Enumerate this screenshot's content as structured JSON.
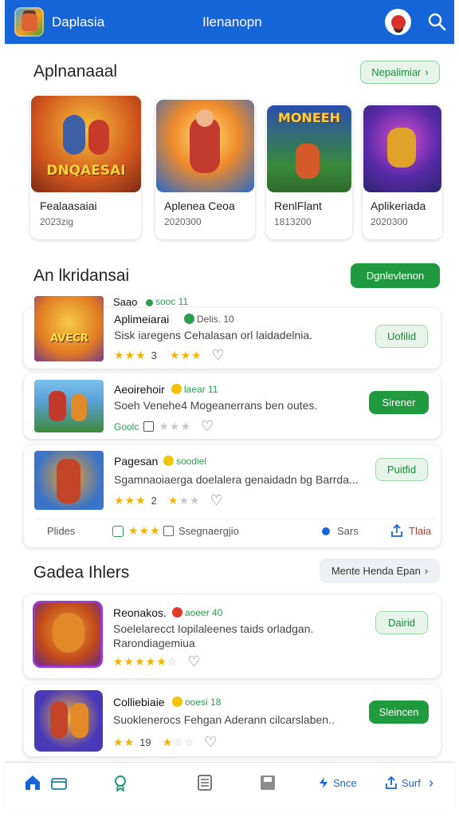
{
  "header": {
    "app_name": "Daplasia",
    "title": "Ilenanopn"
  },
  "featured": {
    "title": "Aplnanaaal",
    "button": "Nepalimiar",
    "items": [
      {
        "name": "Fealaasaiai",
        "sub": "2023zig",
        "art": "DNQAESAI"
      },
      {
        "name": "Aplenea Ceoa",
        "sub": "2020300",
        "art": ""
      },
      {
        "name": "RenlFlant",
        "sub": "1813200",
        "art": "MONEEH"
      },
      {
        "name": "Aplikeriada",
        "sub": "2020300",
        "art": ""
      }
    ]
  },
  "list_section": {
    "title": "An lkridansai",
    "button": "Dgnlevlenon",
    "header_name": "Saao",
    "header_tag": "sooc 11",
    "items": [
      {
        "name": "Aplimeiarai",
        "tag": "Delis. 10",
        "desc": "Sisk iaregens Cehalasan orl laidadelnia.",
        "stars_on": "★★★",
        "rating": "3",
        "stars_on2": "★★★",
        "stars_off": "",
        "button": "Uofilid",
        "style": "light",
        "banner": "AVECR"
      },
      {
        "name": "Aeoirehoir",
        "tag": "laear 11",
        "desc": "Soeh Venehe4 Mogeanerrans ben outes.",
        "stars_on": "",
        "rating": "Goolc",
        "stars_on2": "",
        "stars_off": "★★★",
        "button": "Sirener",
        "style": "solid",
        "banner": ""
      },
      {
        "name": "Pagesan",
        "tag": "soodiel",
        "desc": "Sgamnaoiaerga doelalera genaidadn bg Barrda...",
        "stars_on": "★★★",
        "rating": "2",
        "stars_on2": "★",
        "stars_off": "★★",
        "button": "Puitfid",
        "style": "light",
        "banner": ""
      }
    ],
    "footer": {
      "label": "Plides",
      "stars": "★★★",
      "sub": "Ssegnaergjio",
      "count": "Sars",
      "share": "Tlaia"
    }
  },
  "games_section": {
    "title": "Gadea Ihlers",
    "button": "Mente Henda Epan",
    "items": [
      {
        "name": "Reonakos.",
        "tag": "aoeer 40",
        "desc": "Soelelarecct Iopilaleenes taids orladgan.",
        "desc2": "Rarondiagemiua",
        "stars_on": "★★★★★",
        "rating": "",
        "stars_on2": "",
        "stars_off": "☆",
        "button": "Dairid",
        "style": "light"
      },
      {
        "name": "Colliebiaie",
        "tag": "ooesi 18",
        "desc": "Suoklenerocs Fehgan Aderann cilcarslaben..",
        "desc2": "",
        "stars_on": "★★",
        "rating": "19",
        "stars_on2": "★",
        "stars_off": "☆☆",
        "button": "Sleincen",
        "style": "solid"
      }
    ]
  },
  "bottom_nav": {
    "label1": "Snce",
    "label2": "Surf"
  },
  "colors": {
    "primary": "#1565d8",
    "accent_green": "#1f9a3e",
    "star": "#f2b400"
  }
}
